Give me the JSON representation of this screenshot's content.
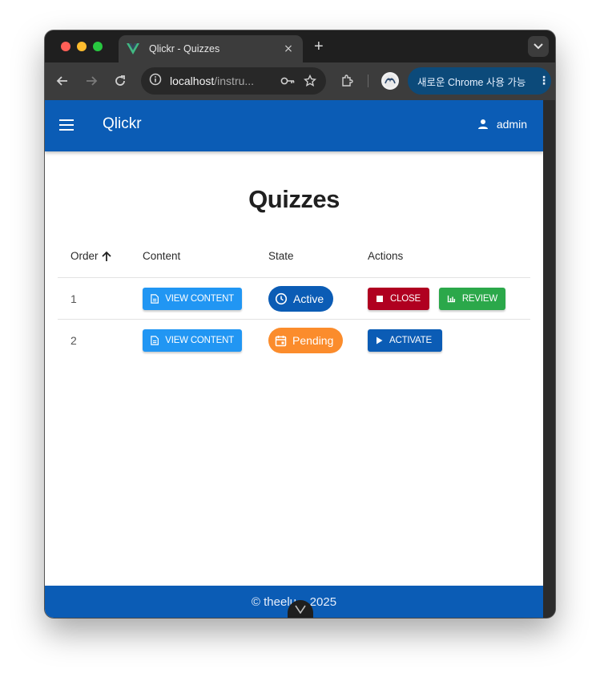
{
  "browser": {
    "tab_title": "Qlickr - Quizzes",
    "tab_close": "×",
    "new_tab": "+",
    "url_host": "localhost",
    "url_path": "/instru...",
    "promo_label": "새로운 Chrome 사용 가능",
    "icons": [
      "back-icon",
      "forward-icon",
      "reload-icon",
      "info-icon",
      "key-icon",
      "star-icon",
      "extensions-icon",
      "profile-icon",
      "more-icon"
    ]
  },
  "app": {
    "title": "Qlickr",
    "user": "admin",
    "brand_color": "#0b5cb5"
  },
  "page": {
    "heading": "Quizzes",
    "columns": {
      "order": "Order",
      "content": "Content",
      "state": "State",
      "actions": "Actions"
    },
    "rows": [
      {
        "order": "1",
        "content_button": "VIEW CONTENT",
        "state": "Active",
        "state_color": "#0b5cb5",
        "actions": [
          "CLOSE",
          "REVIEW"
        ]
      },
      {
        "order": "2",
        "content_button": "VIEW CONTENT",
        "state": "Pending",
        "state_color": "#fb8c2c",
        "actions": [
          "ACTIVATE"
        ]
      }
    ]
  },
  "footer": {
    "text": "© theelu... 2025"
  }
}
